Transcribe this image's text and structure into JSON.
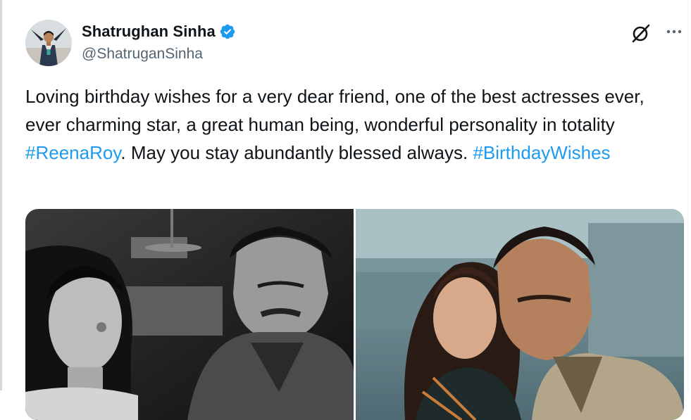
{
  "tweet": {
    "author_name": "Shatrughan Sinha",
    "author_handle": "@ShatruganSinha",
    "text_part1": "Loving birthday wishes for a very dear friend, one of the best actresses ever, ever charming star, a great human being, wonderful personality in totality ",
    "hashtag1": "#ReenaRoy",
    "text_part2": ". May you stay abundantly blessed always. ",
    "hashtag2": "#BirthdayWishes"
  },
  "icons": {
    "verified": "verified-badge-icon",
    "grok": "grok-icon",
    "more": "more-options-icon"
  },
  "colors": {
    "link": "#1d9bf0",
    "text": "#0f1419",
    "secondary": "#536471"
  }
}
